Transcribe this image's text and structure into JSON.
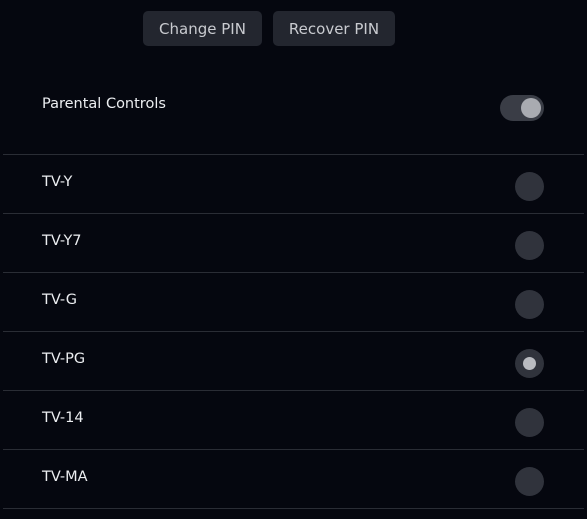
{
  "buttons": {
    "change_pin": "Change PIN",
    "recover_pin": "Recover PIN"
  },
  "parental_controls": {
    "label": "Parental Controls",
    "enabled": true
  },
  "ratings": [
    {
      "label": "TV-Y",
      "selected": false
    },
    {
      "label": "TV-Y7",
      "selected": false
    },
    {
      "label": "TV-G",
      "selected": false
    },
    {
      "label": "TV-PG",
      "selected": true
    },
    {
      "label": "TV-14",
      "selected": false
    },
    {
      "label": "TV-MA",
      "selected": false
    }
  ]
}
